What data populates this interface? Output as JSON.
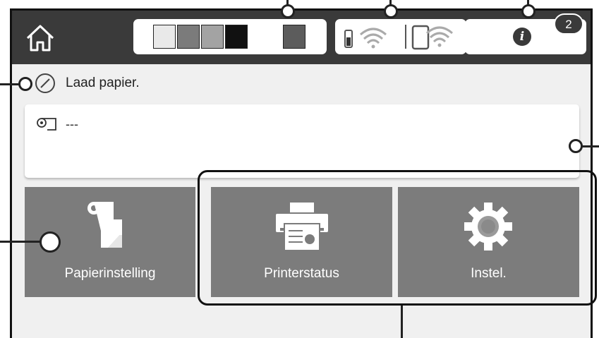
{
  "status_bar": {
    "ink_slots": [
      {
        "color": "#e9e9e9"
      },
      {
        "color": "#7b7b7b"
      },
      {
        "color": "#a3a3a3"
      },
      {
        "color": "#111111"
      },
      {
        "color": "#ffffff"
      },
      {
        "color": "#5c5c5c"
      }
    ],
    "info_badge_count": "2"
  },
  "message": {
    "text": "Laad papier."
  },
  "paper_info": {
    "text": "---"
  },
  "tiles": [
    {
      "label": "Papierinstelling",
      "icon": "paper-setting-icon"
    },
    {
      "label": "Printerstatus",
      "icon": "printer-icon"
    },
    {
      "label": "Instel.",
      "icon": "gear-icon"
    }
  ],
  "colors": {
    "topbar": "#3a3a3a",
    "tile": "#7c7c7c",
    "background": "#f0f0f0"
  }
}
